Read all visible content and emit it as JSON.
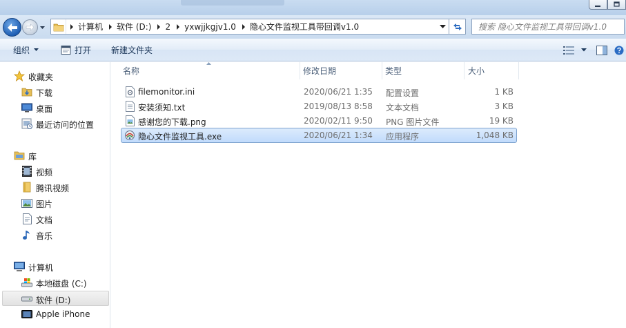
{
  "window": {
    "buttons": {
      "minimize": "minimize-icon",
      "maximize": "maximize-icon"
    }
  },
  "navigation": {
    "back_icon": "back-arrow-icon",
    "forward_icon": "forward-arrow-icon",
    "history_icon": "chevron-down-icon"
  },
  "address": {
    "breadcrumbs": [
      {
        "label": "计算机"
      },
      {
        "label": "软件 (D:)"
      },
      {
        "label": "2"
      },
      {
        "label": "yxwjjkgjv1.0"
      },
      {
        "label": "隐心文件监视工具带回调v1.0"
      }
    ]
  },
  "search": {
    "placeholder": "搜索 隐心文件监视工具带回调v1.0"
  },
  "toolbar": {
    "organize": "组织",
    "open": "打开",
    "new_folder": "新建文件夹"
  },
  "sidebar": {
    "favorites": {
      "label": "收藏夹",
      "items": [
        {
          "label": "下载",
          "icon": "downloads-folder-icon"
        },
        {
          "label": "桌面",
          "icon": "desktop-icon"
        },
        {
          "label": "最近访问的位置",
          "icon": "recent-places-icon"
        }
      ]
    },
    "libraries": {
      "label": "库",
      "items": [
        {
          "label": "视频",
          "icon": "videos-icon"
        },
        {
          "label": "腾讯视频",
          "icon": "folder-icon"
        },
        {
          "label": "图片",
          "icon": "pictures-icon"
        },
        {
          "label": "文档",
          "icon": "documents-icon"
        },
        {
          "label": "音乐",
          "icon": "music-icon"
        }
      ]
    },
    "computer": {
      "label": "计算机",
      "items": [
        {
          "label": "本地磁盘 (C:)",
          "icon": "system-drive-icon"
        },
        {
          "label": "软件 (D:)",
          "icon": "drive-icon",
          "selected": true
        },
        {
          "label": "Apple iPhone",
          "icon": "iphone-icon"
        }
      ]
    }
  },
  "file_list": {
    "columns": [
      "名称",
      "修改日期",
      "类型",
      "大小"
    ],
    "rows": [
      {
        "name": "filemonitor.ini",
        "modified": "2020/06/21 1:35",
        "type": "配置设置",
        "size": "1 KB",
        "icon": "ini-file-icon"
      },
      {
        "name": "安装须知.txt",
        "modified": "2019/08/13 8:58",
        "type": "文本文档",
        "size": "3 KB",
        "icon": "text-file-icon"
      },
      {
        "name": "感谢您的下载.png",
        "modified": "2020/02/11 9:50",
        "type": "PNG 图片文件",
        "size": "19 KB",
        "icon": "png-file-icon"
      },
      {
        "name": "隐心文件监视工具.exe",
        "modified": "2020/06/21 1:34",
        "type": "应用程序",
        "size": "1,048 KB",
        "icon": "exe-app-icon",
        "selected": true
      }
    ]
  },
  "colors": {
    "accent": "#1f5fb4",
    "selection": "#c1dbfc",
    "toolbar_text": "#1e395b"
  }
}
